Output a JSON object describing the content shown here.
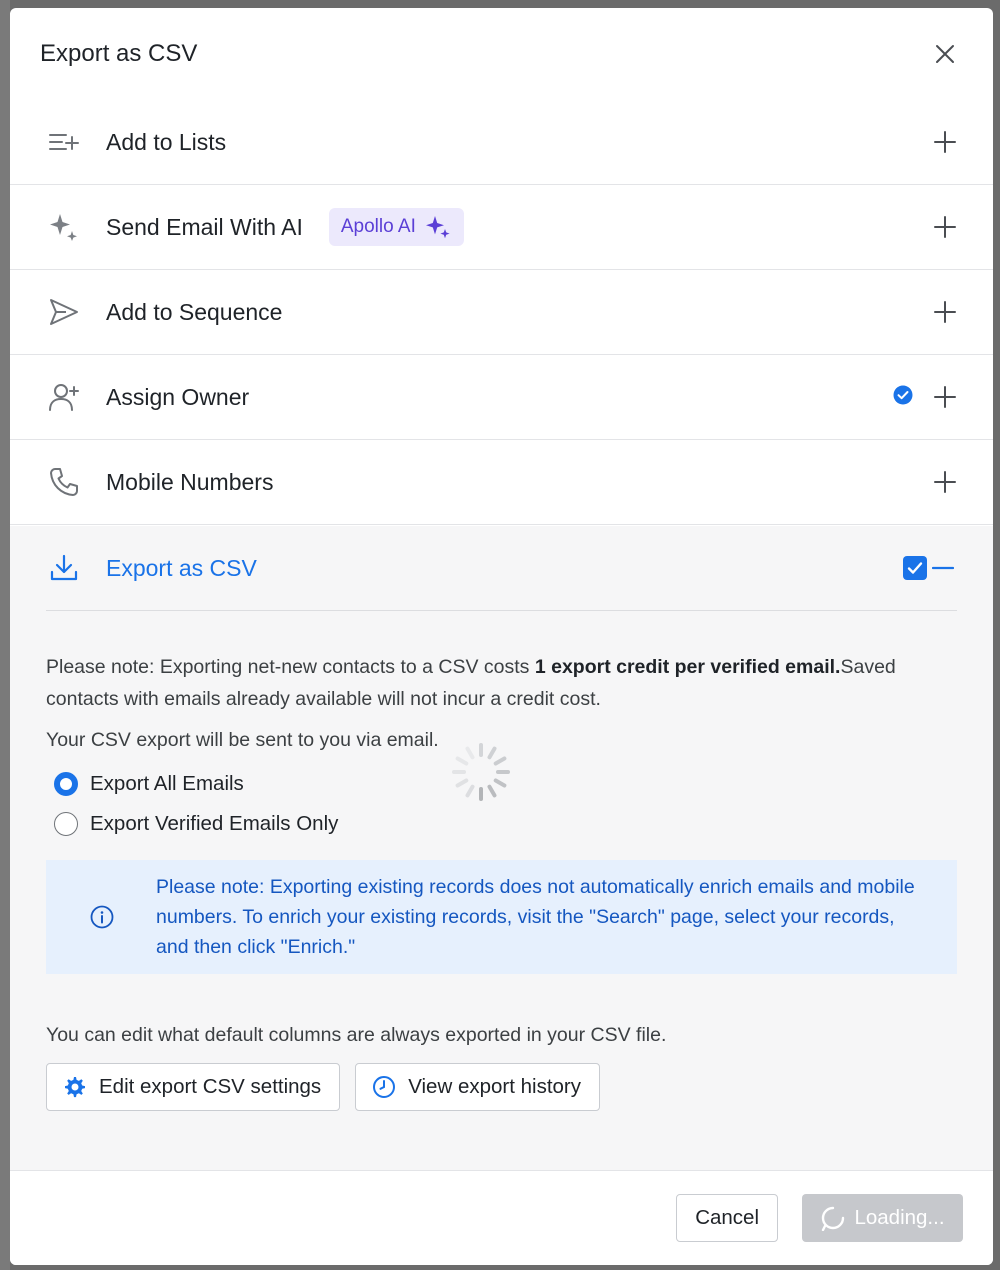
{
  "modal": {
    "title": "Export as CSV"
  },
  "actions": [
    {
      "label": "Add to Lists"
    },
    {
      "label": "Send Email With AI",
      "badge": "Apollo AI"
    },
    {
      "label": "Add to Sequence"
    },
    {
      "label": "Assign Owner",
      "checked": true
    },
    {
      "label": "Mobile Numbers"
    }
  ],
  "export_section": {
    "label": "Export as CSV",
    "enabled": true,
    "note_prefix": "Please note: Exporting net-new contacts to a CSV costs ",
    "note_bold": "1 export credit per verified email.",
    "note_suffix": "Saved contacts with emails already available will not incur a credit cost.",
    "delivery_note": "Your CSV export will be sent to you via email.",
    "options": [
      {
        "label": "Export All Emails",
        "selected": true
      },
      {
        "label": "Export Verified Emails Only",
        "selected": false
      }
    ],
    "info": "Please note: Exporting existing records does not automatically enrich emails and mobile numbers. To enrich your existing records, visit the \"Search\" page, select your records, and then click \"Enrich.\"",
    "columns_note": "You can edit what default columns are always exported in your CSV file.",
    "edit_settings_label": "Edit export CSV settings",
    "history_label": "View export history"
  },
  "footer": {
    "cancel_label": "Cancel",
    "loading_label": "Loading..."
  },
  "colors": {
    "accent": "#1a73e8",
    "ai_badge_bg": "#ece9fc",
    "ai_badge_text": "#5b3fd6",
    "info_bg": "#e6f0fd",
    "disabled_button": "#c6c8cc"
  }
}
